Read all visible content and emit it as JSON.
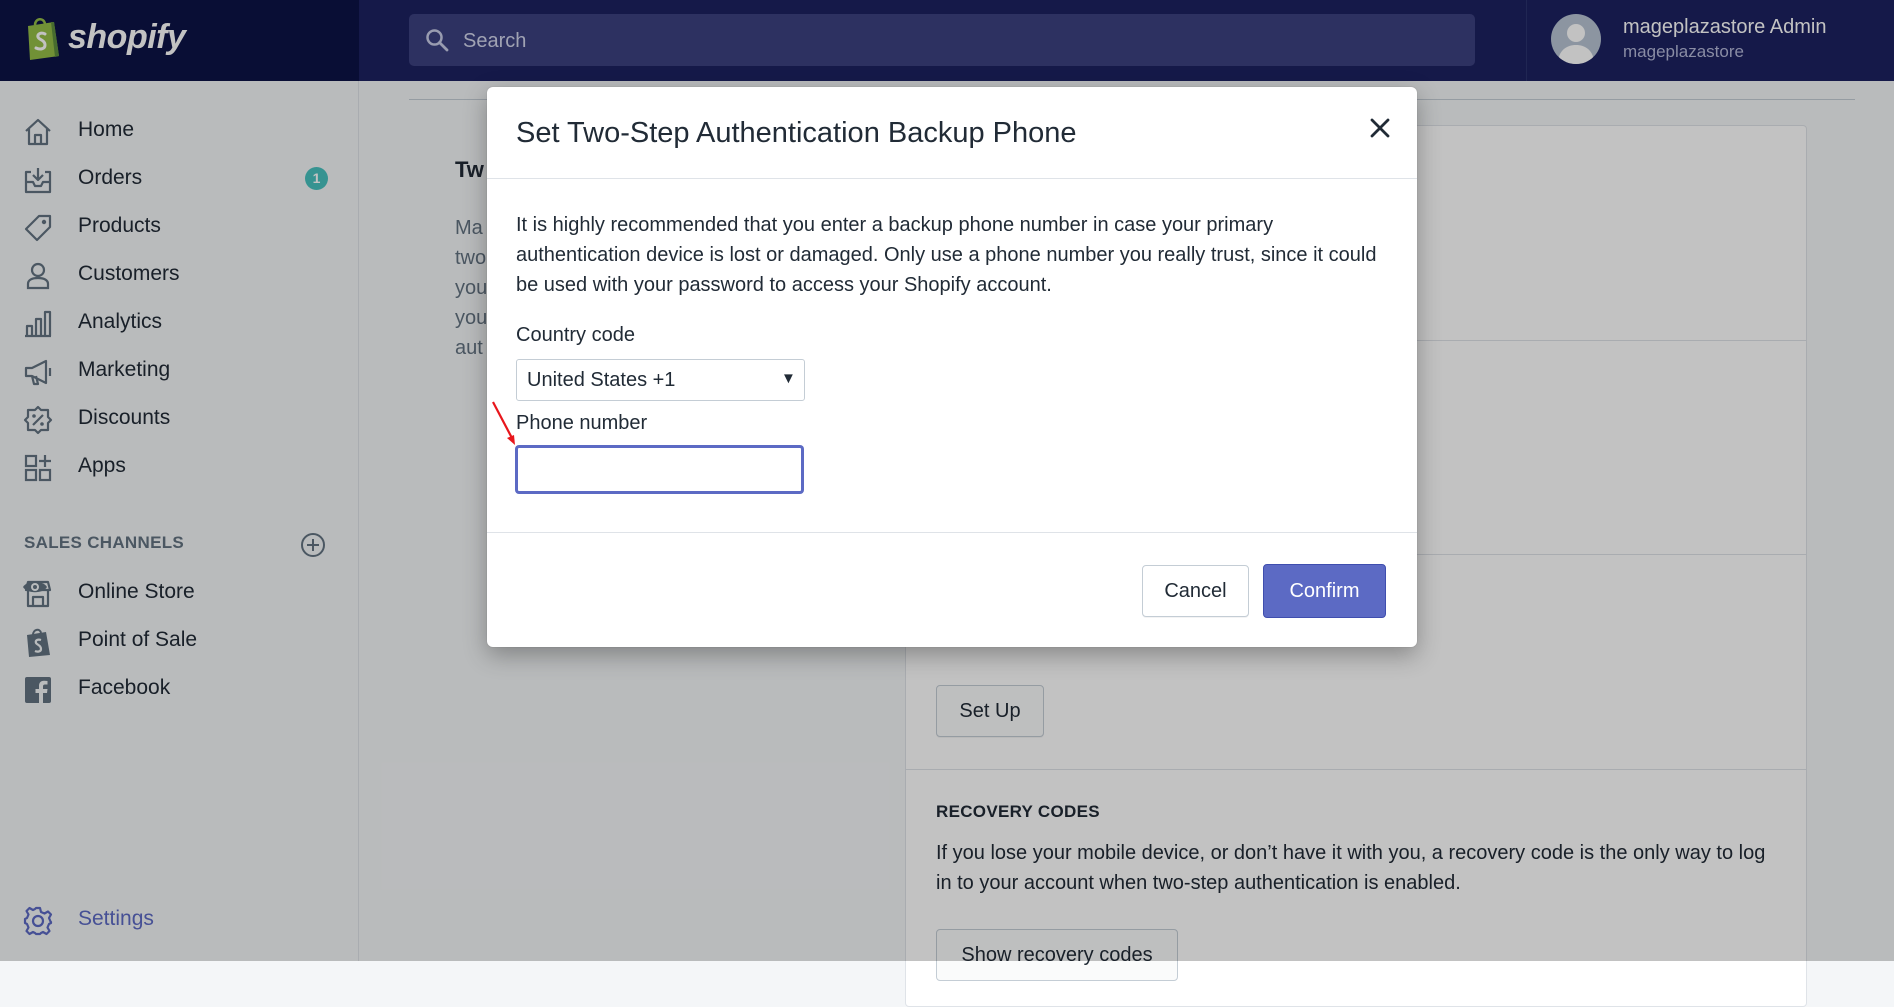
{
  "brand": {
    "name": "shopify"
  },
  "search": {
    "placeholder": "Search"
  },
  "user": {
    "name": "mageplazastore Admin",
    "store": "mageplazastore"
  },
  "sidebar": {
    "items": [
      {
        "label": "Home",
        "icon": "home-icon"
      },
      {
        "label": "Orders",
        "icon": "orders-icon",
        "badge": "1"
      },
      {
        "label": "Products",
        "icon": "tag-icon"
      },
      {
        "label": "Customers",
        "icon": "person-icon"
      },
      {
        "label": "Analytics",
        "icon": "bar-chart-icon"
      },
      {
        "label": "Marketing",
        "icon": "megaphone-icon"
      },
      {
        "label": "Discounts",
        "icon": "discount-icon"
      },
      {
        "label": "Apps",
        "icon": "apps-icon"
      }
    ],
    "sales_channels_title": "SALES CHANNELS",
    "channels": [
      {
        "label": "Online Store",
        "icon": "store-icon"
      },
      {
        "label": "Point of Sale",
        "icon": "pos-bag-icon"
      },
      {
        "label": "Facebook",
        "icon": "facebook-icon"
      }
    ],
    "settings_label": "Settings"
  },
  "page": {
    "left_title": "Tw",
    "left_desc": "Ma\ntwo\nyou\nyou\naut",
    "setup_button": "Set Up",
    "recovery_title": "RECOVERY CODES",
    "recovery_text": "If you lose your mobile device, or don’t have it with you, a recovery code is the only way to log in to your account when two-step authentication is enabled.",
    "show_codes_button": "Show recovery codes"
  },
  "modal": {
    "title": "Set Two-Step Authentication Backup Phone",
    "description": "It is highly recommended that you enter a backup phone number in case your primary authentication device is lost or damaged. Only use a phone number you really trust, since it could be used with your password to access your Shopify account.",
    "country_label": "Country code",
    "country_value": "United States +1",
    "phone_label": "Phone number",
    "phone_value": "",
    "cancel_label": "Cancel",
    "confirm_label": "Confirm"
  },
  "colors": {
    "topbar": "#1c2260",
    "logo_bg": "#0d1346",
    "accent": "#5c6ac4",
    "badge": "#47c1bf",
    "annotation_arrow": "#e8161c"
  }
}
